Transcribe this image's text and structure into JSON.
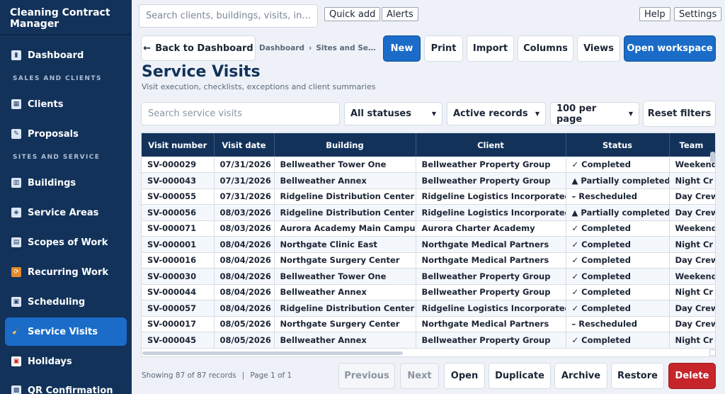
{
  "app": {
    "title": "Cleaning Contract Manager"
  },
  "sidebar": {
    "sections": {
      "sales": "SALES AND CLIENTS",
      "sites": "SITES AND SERVICE"
    },
    "items": [
      {
        "label": "Dashboard",
        "icon": "chart-icon"
      },
      {
        "label": "Clients",
        "icon": "building-icon"
      },
      {
        "label": "Proposals",
        "icon": "memo-icon"
      },
      {
        "label": "Buildings",
        "icon": "buildings-icon"
      },
      {
        "label": "Service Areas",
        "icon": "map-icon"
      },
      {
        "label": "Scopes of Work",
        "icon": "clipboard-icon"
      },
      {
        "label": "Recurring Work",
        "icon": "repeat-icon"
      },
      {
        "label": "Scheduling",
        "icon": "calendar-icon"
      },
      {
        "label": "Service Visits",
        "icon": "broom-icon",
        "active": true
      },
      {
        "label": "Holidays",
        "icon": "calendar-date-icon"
      },
      {
        "label": "QR Confirmation",
        "icon": "qr-icon"
      }
    ]
  },
  "topbar": {
    "search_placeholder": "Search clients, buildings, visits, in...",
    "quick_add": "Quick add",
    "alerts": "Alerts",
    "help": "Help",
    "settings": "Settings"
  },
  "toolbar": {
    "back_arrow": "←",
    "back": "Back to Dashboard",
    "breadcrumb": [
      "Dashboard",
      "Sites and Serv..."
    ],
    "breadcrumb_sep": "›",
    "new": "New",
    "print": "Print",
    "import": "Import",
    "columns": "Columns",
    "views": "Views",
    "open_workspace": "Open workspace"
  },
  "page": {
    "title": "Service Visits",
    "subtitle": "Visit execution, checklists, exceptions and client summaries"
  },
  "filters": {
    "search_placeholder": "Search service visits",
    "status": "All statuses",
    "records": "Active records",
    "per_page": "100 per page",
    "reset": "Reset filters"
  },
  "table": {
    "columns": [
      "Visit number",
      "Visit date",
      "Building",
      "Client",
      "Status",
      "Team"
    ],
    "rows": [
      [
        "SV-000029",
        "07/31/2026",
        "Bellweather Tower One",
        "Bellweather Property Group",
        "✓ Completed",
        "Weekend"
      ],
      [
        "SV-000043",
        "07/31/2026",
        "Bellweather Annex",
        "Bellweather Property Group",
        "▲ Partially completed",
        "Night Cr"
      ],
      [
        "SV-000055",
        "07/31/2026",
        "Ridgeline Distribution Center",
        "Ridgeline Logistics Incorporated",
        "– Rescheduled",
        "Day Crew"
      ],
      [
        "SV-000056",
        "08/03/2026",
        "Ridgeline Distribution Center",
        "Ridgeline Logistics Incorporated",
        "▲ Partially completed",
        "Day Crew"
      ],
      [
        "SV-000071",
        "08/03/2026",
        "Aurora Academy Main Campus",
        "Aurora Charter Academy",
        "✓ Completed",
        "Weekend"
      ],
      [
        "SV-000001",
        "08/04/2026",
        "Northgate Clinic East",
        "Northgate Medical Partners",
        "✓ Completed",
        "Night Cr"
      ],
      [
        "SV-000016",
        "08/04/2026",
        "Northgate Surgery Center",
        "Northgate Medical Partners",
        "✓ Completed",
        "Day Crew"
      ],
      [
        "SV-000030",
        "08/04/2026",
        "Bellweather Tower One",
        "Bellweather Property Group",
        "✓ Completed",
        "Weekend"
      ],
      [
        "SV-000044",
        "08/04/2026",
        "Bellweather Annex",
        "Bellweather Property Group",
        "✓ Completed",
        "Night Cr"
      ],
      [
        "SV-000057",
        "08/04/2026",
        "Ridgeline Distribution Center",
        "Ridgeline Logistics Incorporated",
        "✓ Completed",
        "Day Crew"
      ],
      [
        "SV-000017",
        "08/05/2026",
        "Northgate Surgery Center",
        "Northgate Medical Partners",
        "– Rescheduled",
        "Day Crew"
      ],
      [
        "SV-000045",
        "08/05/2026",
        "Bellweather Annex",
        "Bellweather Property Group",
        "✓ Completed",
        "Night Cr"
      ]
    ]
  },
  "footer": {
    "showing": "Showing 87 of 87 records",
    "page": "Page 1 of 1",
    "sep": "|",
    "previous": "Previous",
    "next": "Next",
    "open": "Open",
    "duplicate": "Duplicate",
    "archive": "Archive",
    "restore": "Restore",
    "delete": "Delete"
  },
  "colors": {
    "sidebar_bg": "#12325a",
    "accent": "#1a6cc8",
    "completed": "#21a05a",
    "partial": "#d98b12",
    "rescheduled": "#6d7684",
    "danger": "#c6262a"
  }
}
